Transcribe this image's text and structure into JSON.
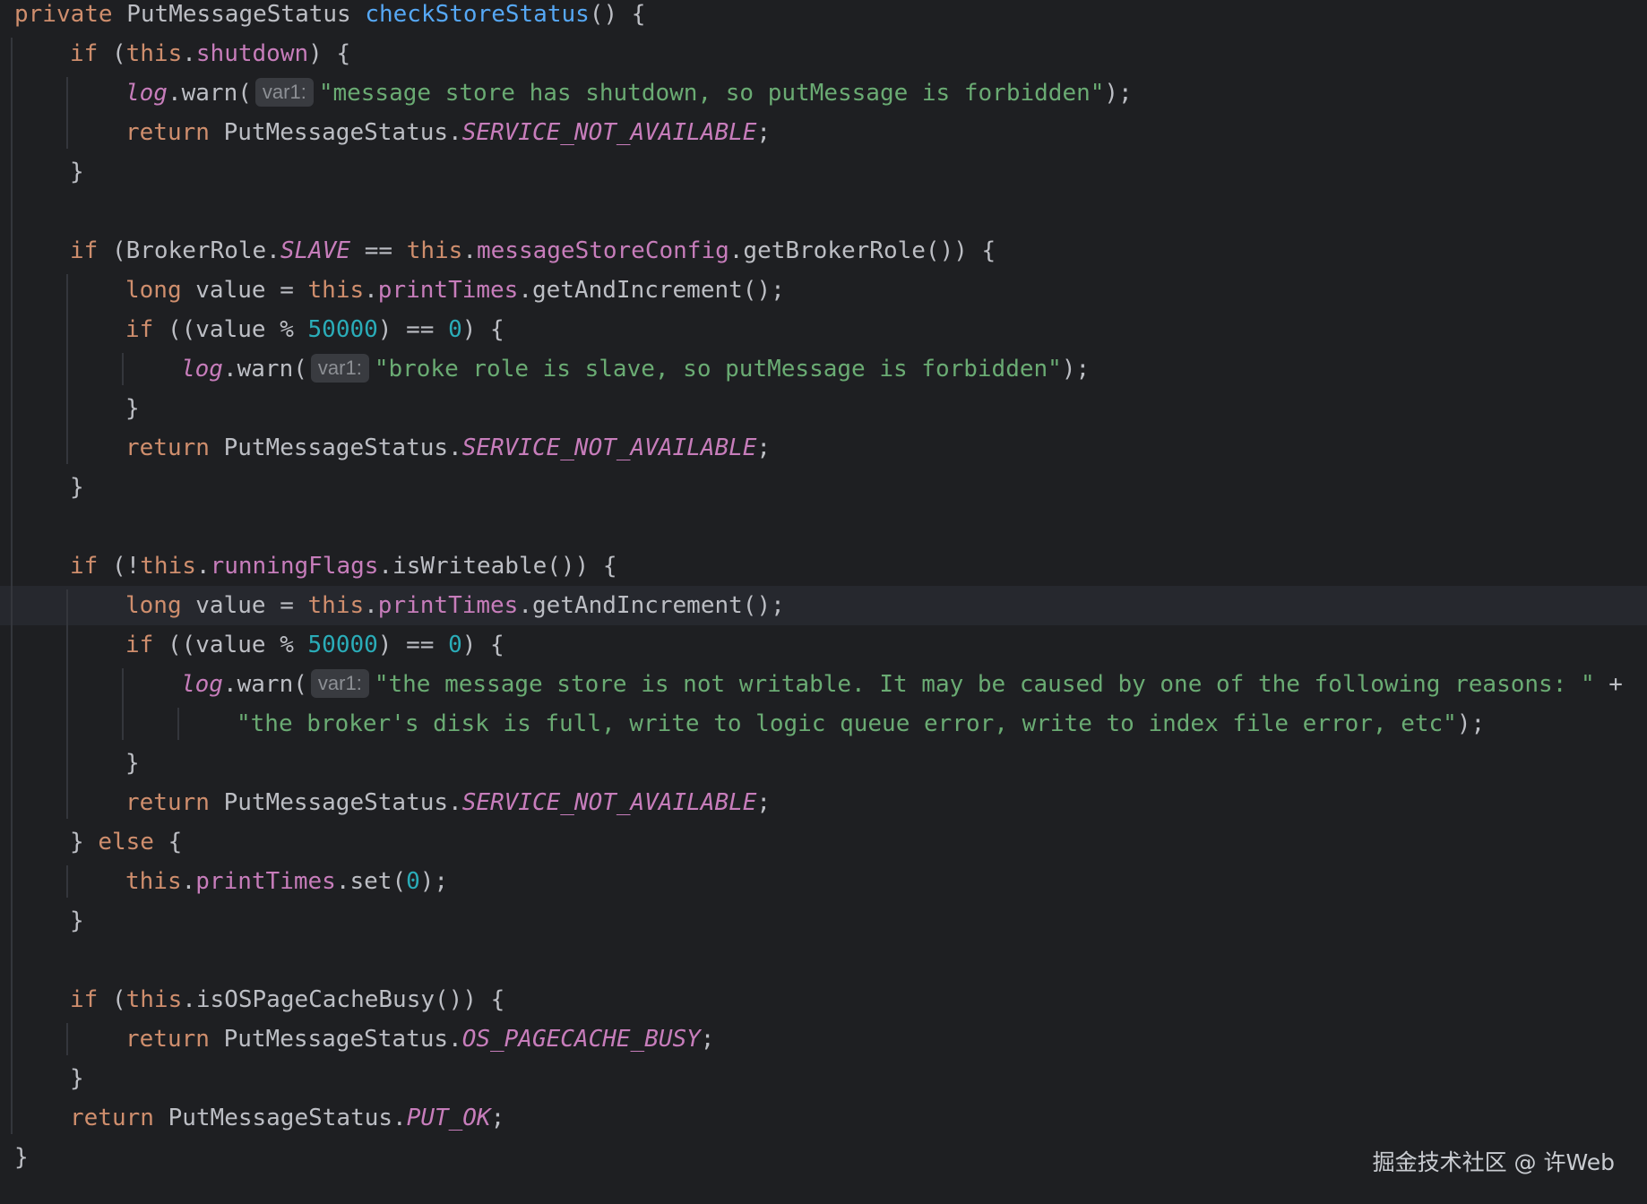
{
  "editor": {
    "lines": [
      {
        "indent": 0,
        "tokens": [
          {
            "t": "private ",
            "c": "kw"
          },
          {
            "t": "PutMessageStatus "
          },
          {
            "t": "checkStoreStatus",
            "c": "fn"
          },
          {
            "t": "() {"
          }
        ]
      },
      {
        "indent": 1,
        "tokens": [
          {
            "t": "if ",
            "c": "kw"
          },
          {
            "t": "("
          },
          {
            "t": "this",
            "c": "kw"
          },
          {
            "t": "."
          },
          {
            "t": "shutdown",
            "c": "fld"
          },
          {
            "t": ") {"
          }
        ]
      },
      {
        "indent": 2,
        "tokens": [
          {
            "t": "log",
            "c": "fld static"
          },
          {
            "t": ".warn("
          },
          {
            "hint": "var1:"
          },
          {
            "t": "\"message store has shutdown, so putMessage is forbidden\"",
            "c": "str"
          },
          {
            "t": ");"
          }
        ]
      },
      {
        "indent": 2,
        "tokens": [
          {
            "t": "return ",
            "c": "kw"
          },
          {
            "t": "PutMessageStatus."
          },
          {
            "t": "SERVICE_NOT_AVAILABLE",
            "c": "cst"
          },
          {
            "t": ";"
          }
        ]
      },
      {
        "indent": 1,
        "tokens": [
          {
            "t": "}"
          }
        ]
      },
      {
        "indent": 0,
        "tokens": []
      },
      {
        "indent": 1,
        "tokens": [
          {
            "t": "if ",
            "c": "kw"
          },
          {
            "t": "(BrokerRole."
          },
          {
            "t": "SLAVE",
            "c": "cst"
          },
          {
            "t": " == "
          },
          {
            "t": "this",
            "c": "kw"
          },
          {
            "t": "."
          },
          {
            "t": "messageStoreConfig",
            "c": "fld"
          },
          {
            "t": ".getBrokerRole()) {"
          }
        ]
      },
      {
        "indent": 2,
        "tokens": [
          {
            "t": "long ",
            "c": "kw"
          },
          {
            "t": "value = "
          },
          {
            "t": "this",
            "c": "kw"
          },
          {
            "t": "."
          },
          {
            "t": "printTimes",
            "c": "fld"
          },
          {
            "t": ".getAndIncrement();"
          }
        ]
      },
      {
        "indent": 2,
        "tokens": [
          {
            "t": "if ",
            "c": "kw"
          },
          {
            "t": "((value % "
          },
          {
            "t": "50000",
            "c": "num"
          },
          {
            "t": ") == "
          },
          {
            "t": "0",
            "c": "num"
          },
          {
            "t": ") {"
          }
        ]
      },
      {
        "indent": 3,
        "tokens": [
          {
            "t": "log",
            "c": "fld static"
          },
          {
            "t": ".warn("
          },
          {
            "hint": "var1:"
          },
          {
            "t": "\"broke role is slave, so putMessage is forbidden\"",
            "c": "str"
          },
          {
            "t": ");"
          }
        ]
      },
      {
        "indent": 2,
        "tokens": [
          {
            "t": "}"
          }
        ]
      },
      {
        "indent": 2,
        "tokens": [
          {
            "t": "return ",
            "c": "kw"
          },
          {
            "t": "PutMessageStatus."
          },
          {
            "t": "SERVICE_NOT_AVAILABLE",
            "c": "cst"
          },
          {
            "t": ";"
          }
        ]
      },
      {
        "indent": 1,
        "tokens": [
          {
            "t": "}"
          }
        ]
      },
      {
        "indent": 0,
        "tokens": []
      },
      {
        "indent": 1,
        "tokens": [
          {
            "t": "if ",
            "c": "kw"
          },
          {
            "t": "(!"
          },
          {
            "t": "this",
            "c": "kw"
          },
          {
            "t": "."
          },
          {
            "t": "runningFlags",
            "c": "fld"
          },
          {
            "t": ".isWriteable()) {"
          }
        ]
      },
      {
        "indent": 2,
        "current": true,
        "tokens": [
          {
            "t": "long ",
            "c": "kw"
          },
          {
            "t": "value = "
          },
          {
            "t": "this",
            "c": "kw"
          },
          {
            "t": "."
          },
          {
            "t": "printTimes",
            "c": "fld"
          },
          {
            "t": ".getAndIncrement();"
          }
        ]
      },
      {
        "indent": 2,
        "tokens": [
          {
            "t": "if ",
            "c": "kw"
          },
          {
            "t": "((value % "
          },
          {
            "t": "50000",
            "c": "num"
          },
          {
            "t": ") == "
          },
          {
            "t": "0",
            "c": "num"
          },
          {
            "t": ") {"
          }
        ]
      },
      {
        "indent": 3,
        "tokens": [
          {
            "t": "log",
            "c": "fld static"
          },
          {
            "t": ".warn("
          },
          {
            "hint": "var1:"
          },
          {
            "t": "\"the message store is not writable. It may be caused by one of the following reasons: \"",
            "c": "str"
          },
          {
            "t": " +"
          }
        ]
      },
      {
        "indent": 4,
        "tokens": [
          {
            "t": "\"the broker's disk is full, write to logic queue error, write to index file error, etc\"",
            "c": "str"
          },
          {
            "t": ");"
          }
        ]
      },
      {
        "indent": 2,
        "tokens": [
          {
            "t": "}"
          }
        ]
      },
      {
        "indent": 2,
        "tokens": [
          {
            "t": "return ",
            "c": "kw"
          },
          {
            "t": "PutMessageStatus."
          },
          {
            "t": "SERVICE_NOT_AVAILABLE",
            "c": "cst"
          },
          {
            "t": ";"
          }
        ]
      },
      {
        "indent": 1,
        "tokens": [
          {
            "t": "} "
          },
          {
            "t": "else",
            "c": "kw"
          },
          {
            "t": " {"
          }
        ]
      },
      {
        "indent": 2,
        "tokens": [
          {
            "t": "this",
            "c": "kw"
          },
          {
            "t": "."
          },
          {
            "t": "printTimes",
            "c": "fld"
          },
          {
            "t": ".set("
          },
          {
            "t": "0",
            "c": "num"
          },
          {
            "t": ");"
          }
        ]
      },
      {
        "indent": 1,
        "tokens": [
          {
            "t": "}"
          }
        ]
      },
      {
        "indent": 0,
        "tokens": []
      },
      {
        "indent": 1,
        "tokens": [
          {
            "t": "if ",
            "c": "kw"
          },
          {
            "t": "("
          },
          {
            "t": "this",
            "c": "kw"
          },
          {
            "t": ".isOSPageCacheBusy()) {"
          }
        ]
      },
      {
        "indent": 2,
        "tokens": [
          {
            "t": "return ",
            "c": "kw"
          },
          {
            "t": "PutMessageStatus."
          },
          {
            "t": "OS_PAGECACHE_BUSY",
            "c": "cst"
          },
          {
            "t": ";"
          }
        ]
      },
      {
        "indent": 1,
        "tokens": [
          {
            "t": "}"
          }
        ]
      },
      {
        "indent": 1,
        "tokens": [
          {
            "t": "return ",
            "c": "kw"
          },
          {
            "t": "PutMessageStatus."
          },
          {
            "t": "PUT_OK",
            "c": "cst"
          },
          {
            "t": ";"
          }
        ]
      },
      {
        "indent": 0,
        "tokens": [
          {
            "t": "}"
          }
        ]
      }
    ]
  },
  "watermark": {
    "text": "掘金技术社区 @ 许Web"
  },
  "colors": {
    "background": "#1e1f22",
    "keyword": "#cf8e6d",
    "method_declaration": "#56a8f5",
    "field": "#c77dbb",
    "string": "#6aab73",
    "number": "#2aacb8",
    "default_text": "#bcbec4"
  }
}
